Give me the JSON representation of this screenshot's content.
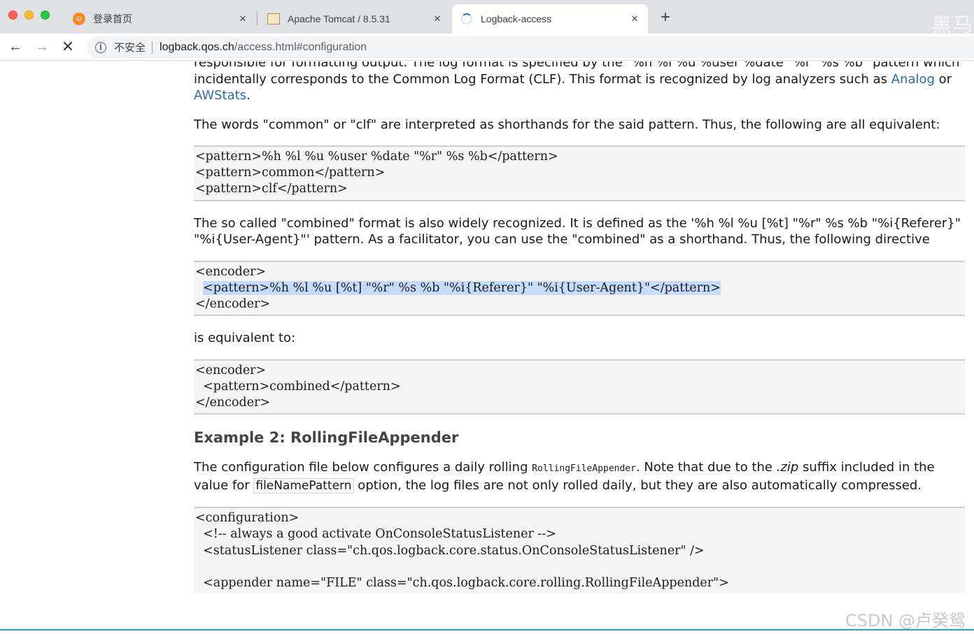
{
  "browser": {
    "tabs": [
      {
        "title": "登录首页",
        "favicon": "orange-circle-icon"
      },
      {
        "title": "Apache Tomcat / 8.5.31",
        "favicon": "tomcat-icon"
      },
      {
        "title": "Logback-access",
        "favicon": "loading-spinner-icon",
        "active": true
      }
    ],
    "new_tab": "+",
    "close_glyph": "×",
    "corner_mark": "黑马"
  },
  "toolbar": {
    "back": "←",
    "forward": "→",
    "stop": "✕",
    "security_label": "不安全",
    "url_host": "logback.qos.ch",
    "url_path": "/access.html#configuration"
  },
  "content": {
    "p1_cut": "responsible for formatting output. The log format is specified by the \"%h %l %u %user %date \"%r\" %s %b\" pattern",
    "p1_rest": "which incidentally corresponds to the Common Log Format (CLF). This format is recognized by log analyzers such as",
    "link_analog": "Analog",
    "word_or": " or ",
    "link_awstats": "AWStats",
    "period": ".",
    "p2": "The words \"common\" or \"clf\" are interpreted as shorthands for the said pattern. Thus, the following are all equivalent:",
    "code1": [
      "<pattern>%h %l %u %user %date \"%r\" %s %b</pattern>",
      "<pattern>common</pattern>",
      "<pattern>clf</pattern>"
    ],
    "p3": "The so called \"combined\" format is also widely recognized. It is defined as the '%h %l %u [%t] \"%r\" %s %b \"%i{Referer}\" \"%i{User-Agent}\"' pattern. As a facilitator, you can use the \"combined\" as a shorthand. Thus, the following directive",
    "code2": {
      "open": "<encoder>",
      "indent": "  ",
      "highlighted": "<pattern>%h %l %u [%t] \"%r\" %s %b \"%i{Referer}\" \"%i{User-Agent}\"</pattern>",
      "close": "</encoder>"
    },
    "p4": "is equivalent to:",
    "code3": [
      "<encoder>",
      "  <pattern>combined</pattern>",
      "</encoder>"
    ],
    "heading": "Example 2: RollingFileAppender",
    "p5_a": "The configuration file below configures a daily rolling ",
    "p5_code": "RollingFileAppender",
    "p5_b": ". Note that due to the ",
    "p5_zip": ".zip",
    "p5_c": " suffix included in the value for ",
    "p5_boxed": "fileNamePattern",
    "p5_d": " option, the log files are not only rolled daily, but they are also automatically compressed.",
    "code4": [
      "<configuration>",
      "  <!-- always a good activate OnConsoleStatusListener -->",
      "  <statusListener class=\"ch.qos.logback.core.status.OnConsoleStatusListener\" />",
      "",
      "  <appender name=\"FILE\" class=\"ch.qos.logback.core.rolling.RollingFileAppender\">"
    ]
  },
  "watermark": "CSDN @卢癸鸳",
  "colors": {
    "link": "#2b6cb0",
    "highlight": "#c7dcf9",
    "accent_line": "#2aa6c9"
  }
}
